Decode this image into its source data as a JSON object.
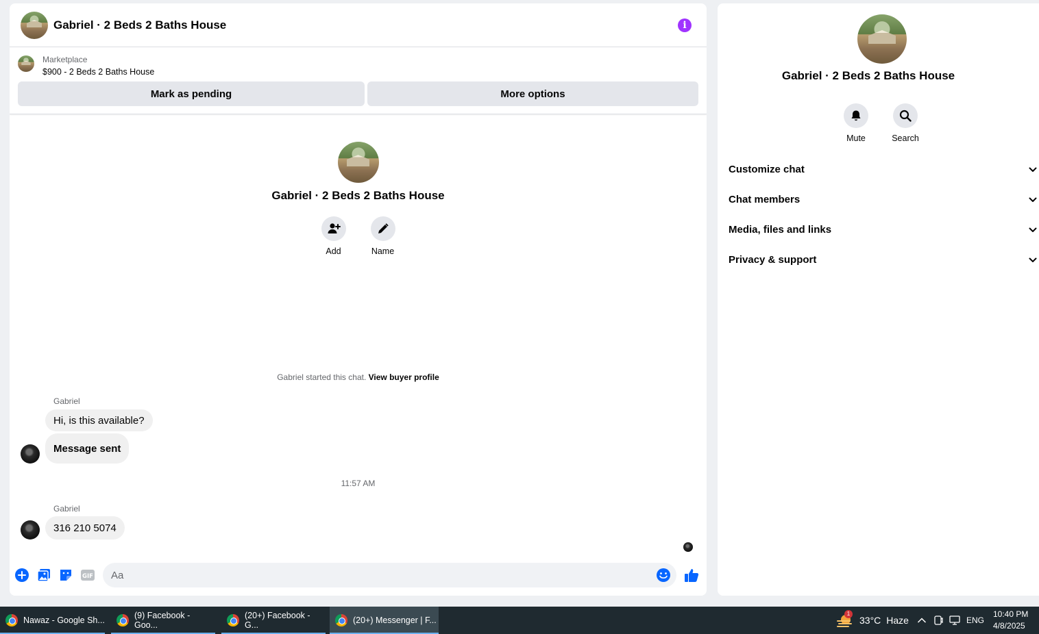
{
  "chat": {
    "title": "Gabriel · 2 Beds 2 Baths House",
    "info_icon": "i",
    "marketplace": {
      "label": "Marketplace",
      "listing": "$900 - 2 Beds 2 Baths House",
      "mark_pending": "Mark as pending",
      "more_options": "More options"
    },
    "intro": {
      "name": "Gabriel · 2 Beds 2 Baths House",
      "actions": [
        {
          "label": "Add",
          "icon": "add-person-icon"
        },
        {
          "label": "Name",
          "icon": "pencil-icon"
        }
      ]
    },
    "started_text": "Gabriel started this chat.",
    "view_buyer_profile": "View buyer profile",
    "messages": [
      {
        "sender": "Gabriel",
        "text": "Hi, is this available?"
      },
      {
        "sender": "",
        "text": "Message sent"
      },
      {
        "sender": "Gabriel",
        "text": "316 210 5074"
      }
    ],
    "timestamp": "11:57 AM",
    "composer": {
      "placeholder": "Aa",
      "gif_label": "GIF"
    }
  },
  "side": {
    "name": "Gabriel · 2 Beds 2 Baths House",
    "actions": [
      {
        "label": "Mute",
        "icon": "bell-icon"
      },
      {
        "label": "Search",
        "icon": "search-icon"
      }
    ],
    "sections": [
      "Customize chat",
      "Chat members",
      "Media, files and links",
      "Privacy & support"
    ]
  },
  "taskbar": {
    "tasks": [
      "Nawaz - Google Sh...",
      "(9) Facebook - Goo...",
      "(20+) Facebook - G...",
      "(20+) Messenger | F..."
    ],
    "weather": {
      "temp": "33°C",
      "condition": "Haze",
      "badge": "1"
    },
    "language": "ENG",
    "time": "10:40 PM",
    "date": "4/8/2025"
  },
  "colors": {
    "accent": "#0866ff",
    "info": "#a033ff",
    "bubble": "#f0f0f0",
    "button": "#e4e6eb"
  }
}
